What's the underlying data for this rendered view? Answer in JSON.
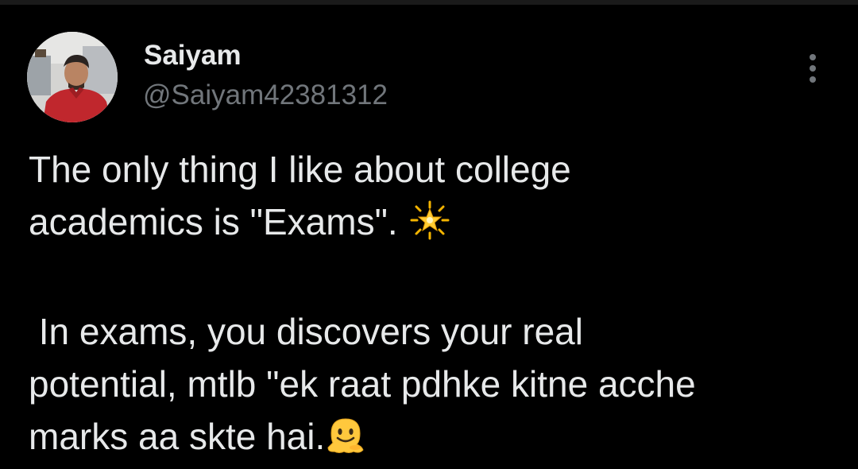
{
  "tweet": {
    "author": {
      "display_name": "Saiyam",
      "handle": "@Saiyam42381312"
    },
    "more_icon": "more-vertical-icon",
    "text_lines": [
      "The only thing I like about college",
      "academics is \"Exams\".",
      " In exams, you discovers your real",
      "potential, mtlb \"ek raat pdhke kitne acche",
      "marks aa skte hai."
    ],
    "emojis": [
      "sparkle-star-emoji",
      "melting-face-emoji"
    ]
  },
  "colors": {
    "background": "#000000",
    "primary_text": "#e7e9ea",
    "secondary_text": "#71767b"
  }
}
